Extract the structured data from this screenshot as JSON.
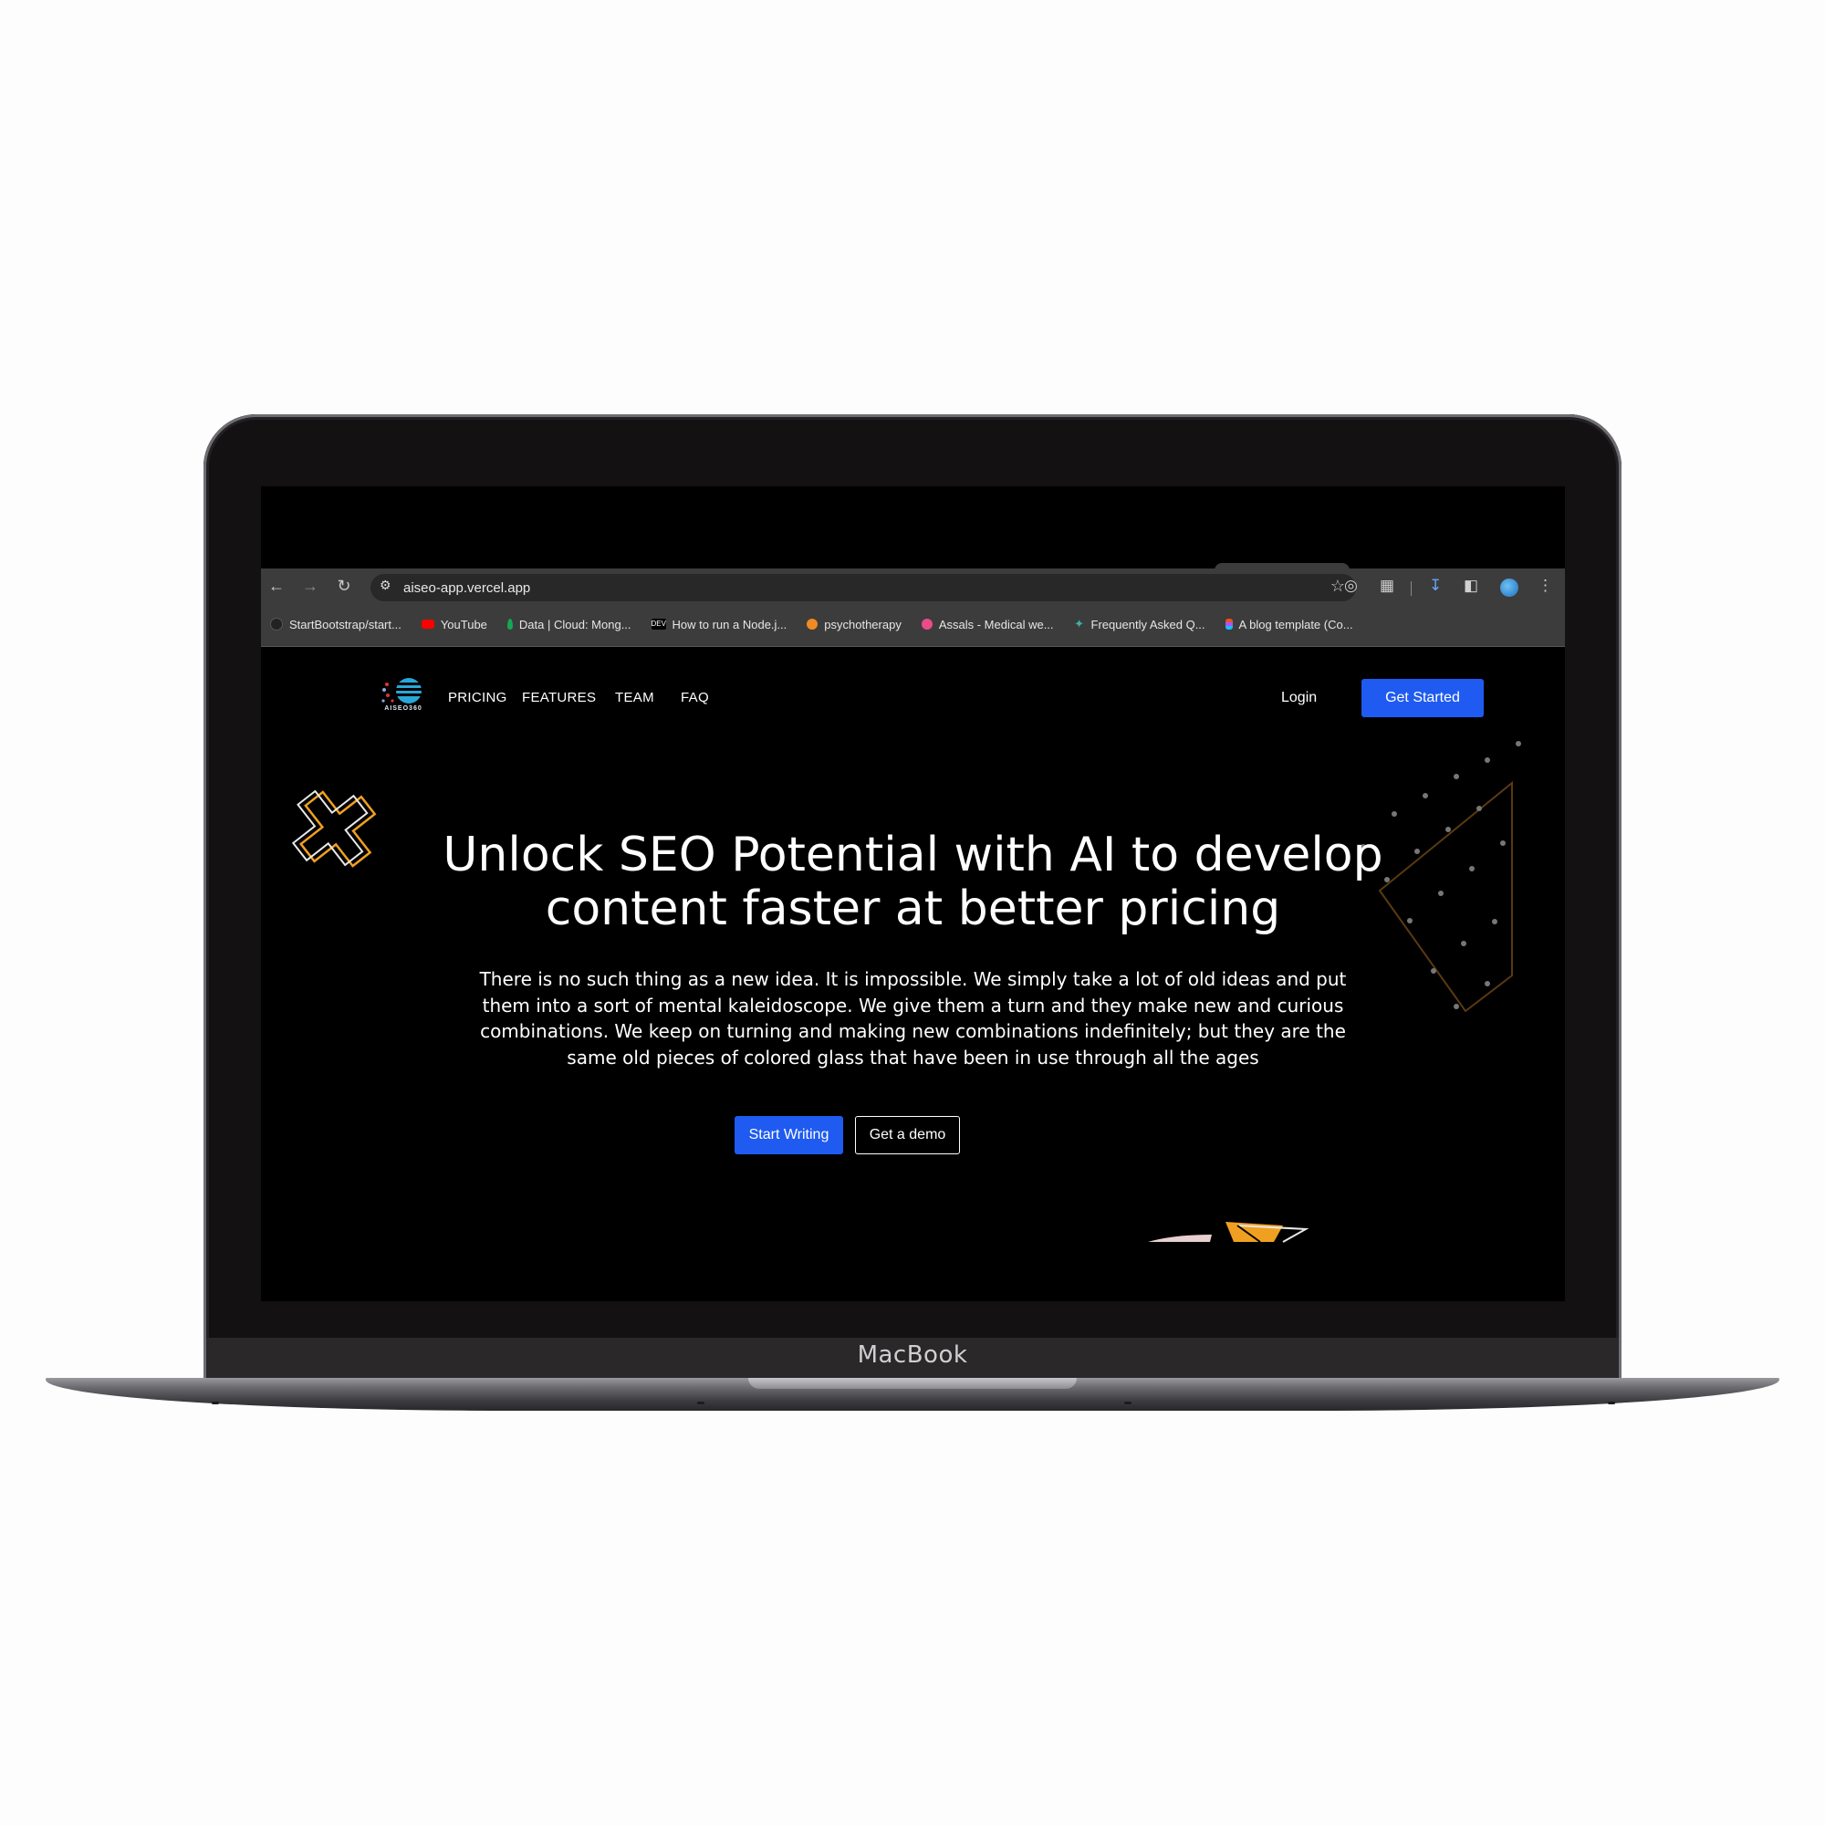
{
  "device": {
    "brand_label": "MacBook"
  },
  "browser": {
    "url": "aiseo-app.vercel.app",
    "bookmarks": [
      {
        "label": "StartBootstrap/start...",
        "icon": "github-icon",
        "color": "#222222"
      },
      {
        "label": "YouTube",
        "icon": "youtube-icon",
        "color": "#ff0000"
      },
      {
        "label": "Data | Cloud: Mong...",
        "icon": "mongodb-icon",
        "color": "#13aa52"
      },
      {
        "label": "How to run a Node.j...",
        "icon": "dev-icon",
        "color": "#000000"
      },
      {
        "label": "psychotherapy",
        "icon": "circle-orange-icon",
        "color": "#f08a24"
      },
      {
        "label": "Assals - Medical we...",
        "icon": "dribbble-icon",
        "color": "#ea4c89"
      },
      {
        "label": "Frequently Asked Q...",
        "icon": "sparkle-icon",
        "color": "#3fb0a9"
      },
      {
        "label": "A blog template (Co...",
        "icon": "figma-icon",
        "color": "#a259ff"
      }
    ]
  },
  "site": {
    "logo_text": "AISEO360",
    "nav": [
      "PRICING",
      "FEATURES",
      "TEAM",
      "FAQ"
    ],
    "login_label": "Login",
    "get_started_label": "Get Started",
    "headline": "Unlock SEO Potential with AI to develop content faster at better pricing",
    "subtext": "There is no such thing as a new idea. It is impossible. We simply take a lot of old ideas and put them into a sort of mental kaleidoscope. We give them a turn and they make new and curious combinations. We keep on turning and making new combinations indefinitely; but they are the same old pieces of colored glass that have been in use through all the ages",
    "start_writing_label": "Start Writing",
    "get_demo_label": "Get a demo"
  },
  "colors": {
    "accent": "#1f5bf0",
    "page_bg": "#000000",
    "chrome_bg": "#3c3c3c",
    "decor_orange": "#f0a020",
    "decor_brown": "#5a3a10"
  }
}
